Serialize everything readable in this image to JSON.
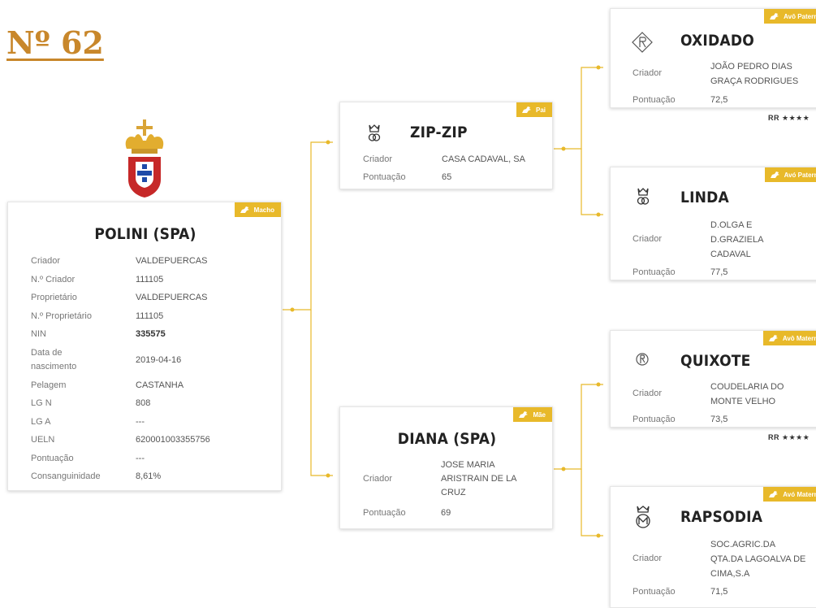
{
  "page": {
    "title": "Nº 62"
  },
  "colors": {
    "accent": "#e8b92a",
    "title": "#c8872b",
    "connector": "#e8b92a"
  },
  "main_horse": {
    "badge": "Macho",
    "name": "POLINI (SPA)",
    "fields": [
      {
        "label": "Criador",
        "value": "VALDEPUERCAS"
      },
      {
        "label": "N.º Criador",
        "value": "111105"
      },
      {
        "label": "Proprietário",
        "value": "VALDEPUERCAS"
      },
      {
        "label": "N.º Proprietário",
        "value": "111105"
      },
      {
        "label": "NIN",
        "value": "335575"
      },
      {
        "label": "Data de nascimento",
        "value": "2019-04-16"
      },
      {
        "label": "Pelagem",
        "value": "CASTANHA"
      },
      {
        "label": "LG N",
        "value": "808"
      },
      {
        "label": "LG A",
        "value": "---"
      },
      {
        "label": "UELN",
        "value": "620001003355756"
      },
      {
        "label": "Pontuação",
        "value": "---"
      },
      {
        "label": "Consanguinidade",
        "value": "8,61%"
      }
    ]
  },
  "sire": {
    "badge": "Pai",
    "name": "ZIP-ZIP",
    "icon": "brand-crown-icon",
    "breeder_label": "Criador",
    "breeder": "CASA CADAVAL, SA",
    "score_label": "Pontuação",
    "score": "65"
  },
  "dam": {
    "badge": "Mãe",
    "name": "DIANA (SPA)",
    "breeder_label": "Criador",
    "breeder": "JOSE MARIA ARISTRAIN DE LA CRUZ",
    "score_label": "Pontuação",
    "score": "69"
  },
  "grandparents": [
    {
      "badge": "Avô Paterno",
      "name": "OXIDADO",
      "icon": "brand-diamond-icon",
      "breeder_label": "Criador",
      "breeder": "JOÃO PEDRO DIAS GRAÇA RODRIGUES",
      "score_label": "Pontuação",
      "score": "72,5",
      "rating": "RR ★★★★"
    },
    {
      "badge": "Avó Paterna",
      "name": "LINDA",
      "icon": "brand-crown-icon",
      "breeder_label": "Criador",
      "breeder": "D.OLGA E D.GRAZIELA CADAVAL",
      "score_label": "Pontuação",
      "score": "77,5"
    },
    {
      "badge": "Avô Materno",
      "name": "QUIXOTE",
      "icon": "brand-circle-icon",
      "breeder_label": "Criador",
      "breeder": "COUDELARIA DO MONTE VELHO",
      "score_label": "Pontuação",
      "score": "73,5",
      "rating": "RR ★★★★"
    },
    {
      "badge": "Avó Materna",
      "name": "RAPSODIA",
      "icon": "brand-crown-m-icon",
      "breeder_label": "Criador",
      "breeder": "SOC.AGRIC.DA QTA.DA LAGOALVA DE CIMA,S.A",
      "score_label": "Pontuação",
      "score": "71,5"
    }
  ]
}
